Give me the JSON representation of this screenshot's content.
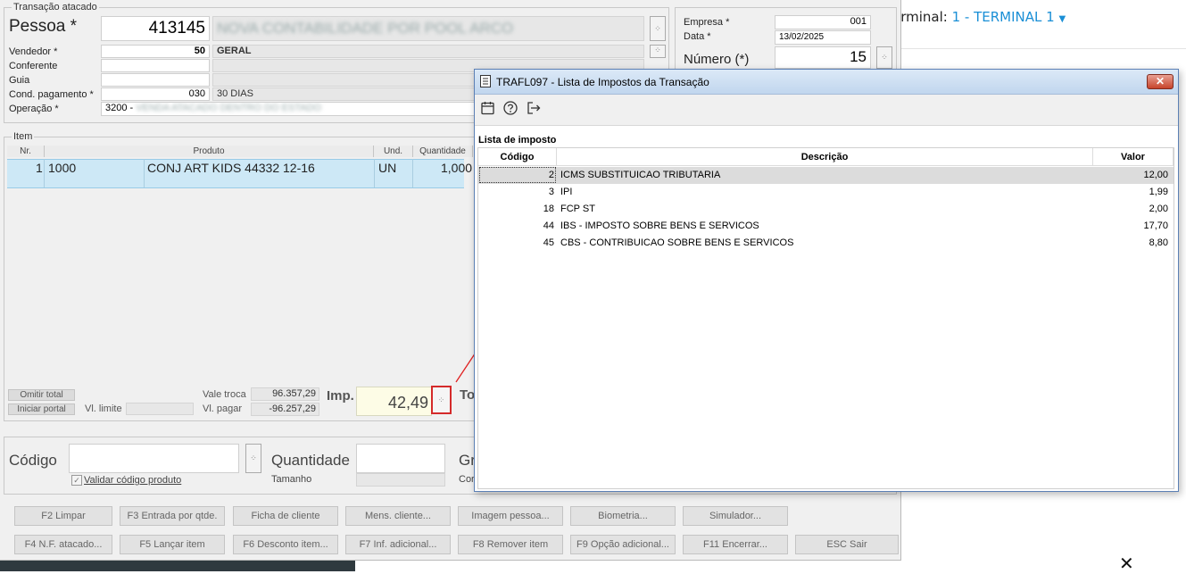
{
  "background_page": {
    "terminal_label": "erminal:",
    "terminal_value": "1 - TERMINAL 1",
    "close_glyph": "✕"
  },
  "main": {
    "group_title": "Transação atacado",
    "pessoa": {
      "label": "Pessoa *",
      "code": "413145",
      "name": "NOVA CONTABILIDADE POR POOL ARCO"
    },
    "vendedor": {
      "label": "Vendedor *",
      "code": "50",
      "name": "GERAL"
    },
    "conferente": {
      "label": "Conferente"
    },
    "guia": {
      "label": "Guia"
    },
    "cond_pagamento": {
      "label": "Cond. pagamento *",
      "code": "030",
      "name": "30 DIAS"
    },
    "operacao": {
      "label": "Operação *",
      "code": "3200 -",
      "name": "VENDA ATACADO DENTRO DO ESTADO"
    },
    "empresa": {
      "label": "Empresa *",
      "value": "001"
    },
    "data": {
      "label": "Data *",
      "value": "13/02/2025"
    },
    "numero": {
      "label": "Número (*)",
      "value": "15"
    },
    "item_group_title": "Item",
    "item_columns": [
      "Nr.",
      "Produto",
      "Und.",
      "Quantidade"
    ],
    "item_row": {
      "nr": "1",
      "code": "1000",
      "produto": "CONJ ART KIDS 44332 12-16",
      "und": "UN",
      "quantidade": "1,000"
    },
    "omitir_total": "Omitir total",
    "iniciar_portal": "Iniciar portal",
    "vl_limite_label": "Vl. limite",
    "vale_troca_label": "Vale troca",
    "vale_troca_value": "96.357,29",
    "vl_pagar_label": "Vl. pagar",
    "vl_pagar_value": "-96.257,29",
    "imp_label": "Imp.",
    "imp_value": "42,49",
    "total_label_partial": "To",
    "codigo_label": "Código",
    "validar_label": "Validar código produto",
    "quantidade_label": "Quantidade",
    "tamanho_label": "Tamanho",
    "grade_partial": "Gr",
    "cor_partial": "Cor"
  },
  "function_buttons_row1": [
    "F2 Limpar",
    "F3 Entrada por qtde.",
    "Ficha de cliente",
    "Mens. cliente...",
    "Imagem pessoa...",
    "Biometria...",
    "Simulador..."
  ],
  "function_buttons_row2": [
    "F4 N.F. atacado...",
    "F5 Lançar item",
    "F6 Desconto item...",
    "F7 Inf. adicional...",
    "F8 Remover item",
    "F9 Opção adicional...",
    "F11 Encerrar...",
    "ESC Sair"
  ],
  "dialog": {
    "title": "TRAFL097 - Lista de Impostos da Transação",
    "close_glyph": "✕",
    "section_label": "Lista de imposto",
    "columns": [
      "Código",
      "Descrição",
      "Valor"
    ],
    "rows": [
      {
        "codigo": "2",
        "descricao": "ICMS SUBSTITUICAO TRIBUTARIA",
        "valor": "12,00"
      },
      {
        "codigo": "3",
        "descricao": "IPI",
        "valor": "1,99"
      },
      {
        "codigo": "18",
        "descricao": "FCP ST",
        "valor": "2,00"
      },
      {
        "codigo": "44",
        "descricao": "IBS - IMPOSTO SOBRE BENS E SERVICOS",
        "valor": "17,70"
      },
      {
        "codigo": "45",
        "descricao": "CBS - CONTRIBUICAO SOBRE BENS E SERVICOS",
        "valor": "8,80"
      }
    ],
    "toolbar_icons": [
      "calendar-icon",
      "help-icon",
      "exit-icon"
    ]
  },
  "colors": {
    "accent_link": "#1a8fd6",
    "selection": "#cde8f6",
    "annotation": "#e02020"
  }
}
